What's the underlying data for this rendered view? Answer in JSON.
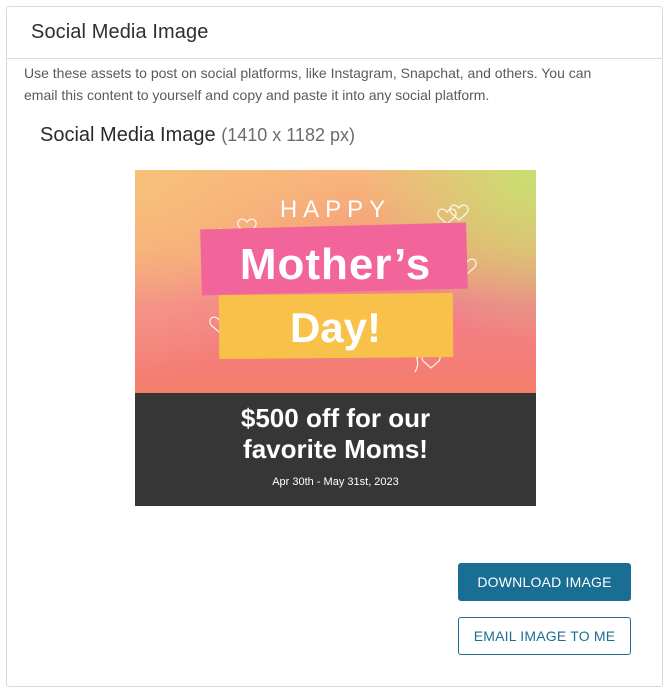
{
  "panel": {
    "title": "Social Media Image",
    "description": "Use these assets to post on social platforms, like Instagram, Snapchat, and others. You can email this content to yourself and copy and paste it into any social platform."
  },
  "asset": {
    "title": "Social Media Image",
    "dimensions": "(1410 x 1182 px)"
  },
  "promo_image": {
    "happy": "HAPPY",
    "mothers": "Mother’s",
    "day": "Day!",
    "offer_line1": "$500 off for our",
    "offer_line2": "favorite Moms!",
    "dates": "Apr 30th - May 31st, 2023",
    "colors": {
      "pink_band": "#f2659a",
      "yellow_band": "#f8c24a",
      "dark_footer": "#363636"
    }
  },
  "actions": {
    "download_label": "DOWNLOAD IMAGE",
    "email_label": "EMAIL IMAGE TO ME",
    "accent": "#1a6e94"
  }
}
